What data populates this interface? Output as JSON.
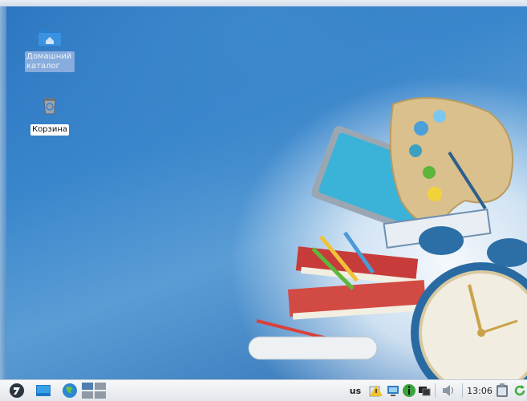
{
  "desktop": {
    "icons": [
      {
        "name": "home-folder",
        "label_line1": "Домашний",
        "label_line2": "каталог",
        "selected": true
      },
      {
        "name": "trash",
        "label": "Корзина"
      }
    ]
  },
  "taskbar": {
    "start_icon": "start-menu-icon",
    "launchers": [
      "show-desktop-icon",
      "browser-icon"
    ],
    "workspaces": [
      "workspace-1",
      "workspace-2",
      "workspace-3",
      "workspace-4"
    ],
    "tray": {
      "keyboard_layout": "us",
      "icons": [
        "update-warning-icon",
        "network-icon",
        "info-icon",
        "display-icon",
        "volume-icon"
      ],
      "clock": "13:06",
      "extra_icons": [
        "clipboard-icon",
        "refresh-icon"
      ]
    }
  },
  "colors": {
    "accent": "#2f7cc4",
    "taskbar": "#eceef1"
  }
}
